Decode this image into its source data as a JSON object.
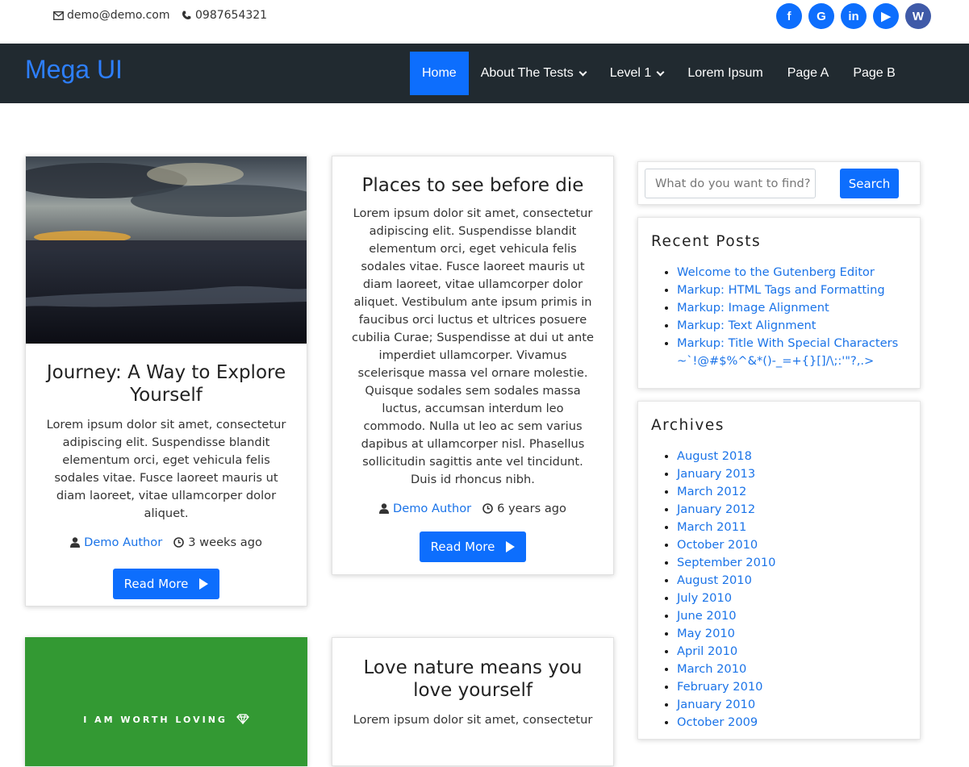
{
  "topbar": {
    "email": "demo@demo.com",
    "phone": "0987654321",
    "socials": [
      {
        "name": "facebook-icon",
        "glyph": "f"
      },
      {
        "name": "google-icon",
        "glyph": "G"
      },
      {
        "name": "linkedin-icon",
        "glyph": "in"
      },
      {
        "name": "youtube-icon",
        "glyph": "▶"
      },
      {
        "name": "wordpress-icon",
        "glyph": "W"
      }
    ]
  },
  "nav": {
    "brand": "Mega UI",
    "items": [
      {
        "label": "Home",
        "active": true,
        "dropdown": false
      },
      {
        "label": "About The Tests",
        "active": false,
        "dropdown": true
      },
      {
        "label": "Level 1",
        "active": false,
        "dropdown": true
      },
      {
        "label": "Lorem Ipsum",
        "active": false,
        "dropdown": false
      },
      {
        "label": "Page A",
        "active": false,
        "dropdown": false
      },
      {
        "label": "Page B",
        "active": false,
        "dropdown": false
      }
    ]
  },
  "posts": [
    {
      "title": "Journey: A Way to Explore Yourself",
      "excerpt": "Lorem ipsum dolor sit amet, consectetur adipiscing elit. Suspendisse blandit elementum orci, eget vehicula felis sodales vitae. Fusce laoreet mauris ut diam laoreet, vitae ullamcorper dolor aliquet.",
      "author": "Demo Author",
      "time": "3 weeks ago",
      "button": "Read More"
    },
    {
      "title": "Places to see before die",
      "excerpt": "Lorem ipsum dolor sit amet, consectetur adipiscing elit. Suspendisse blandit elementum orci, eget vehicula felis sodales vitae. Fusce laoreet mauris ut diam laoreet, vitae ullamcorper dolor aliquet. Vestibulum ante ipsum primis in faucibus orci luctus et ultrices posuere cubilia Curae; Suspendisse at dui ut ante imperdiet ullamcorper. Vivamus scelerisque massa vel ornare molestie. Quisque sodales sem sodales massa luctus, accumsan interdum leo commodo. Nulla ut leo ac sem varius dapibus at ullamcorper nisl. Phasellus sollicitudin sagittis ante vel tincidunt. Duis id rhoncus nibh.",
      "author": "Demo Author",
      "time": "6 years ago",
      "button": "Read More"
    },
    {
      "image_text": "I AM WORTH LOVING"
    },
    {
      "title": "Love nature means you love yourself",
      "excerpt": "Lorem ipsum dolor sit amet, consectetur"
    }
  ],
  "sidebar": {
    "search": {
      "placeholder": "What do you want to find?",
      "button": "Search"
    },
    "recent": {
      "title": "Recent Posts",
      "items": [
        "Welcome to the Gutenberg Editor",
        "Markup: HTML Tags and Formatting",
        "Markup: Image Alignment",
        "Markup: Text Alignment",
        "Markup: Title With Special Characters ~`!@#$%^&*()-_=+{}[]/\\;:'\"?,.>"
      ]
    },
    "archives": {
      "title": "Archives",
      "items": [
        "August 2018",
        "January 2013",
        "March 2012",
        "January 2012",
        "March 2011",
        "October 2010",
        "September 2010",
        "August 2010",
        "July 2010",
        "June 2010",
        "May 2010",
        "April 2010",
        "March 2010",
        "February 2010",
        "January 2010",
        "October 2009"
      ]
    }
  }
}
